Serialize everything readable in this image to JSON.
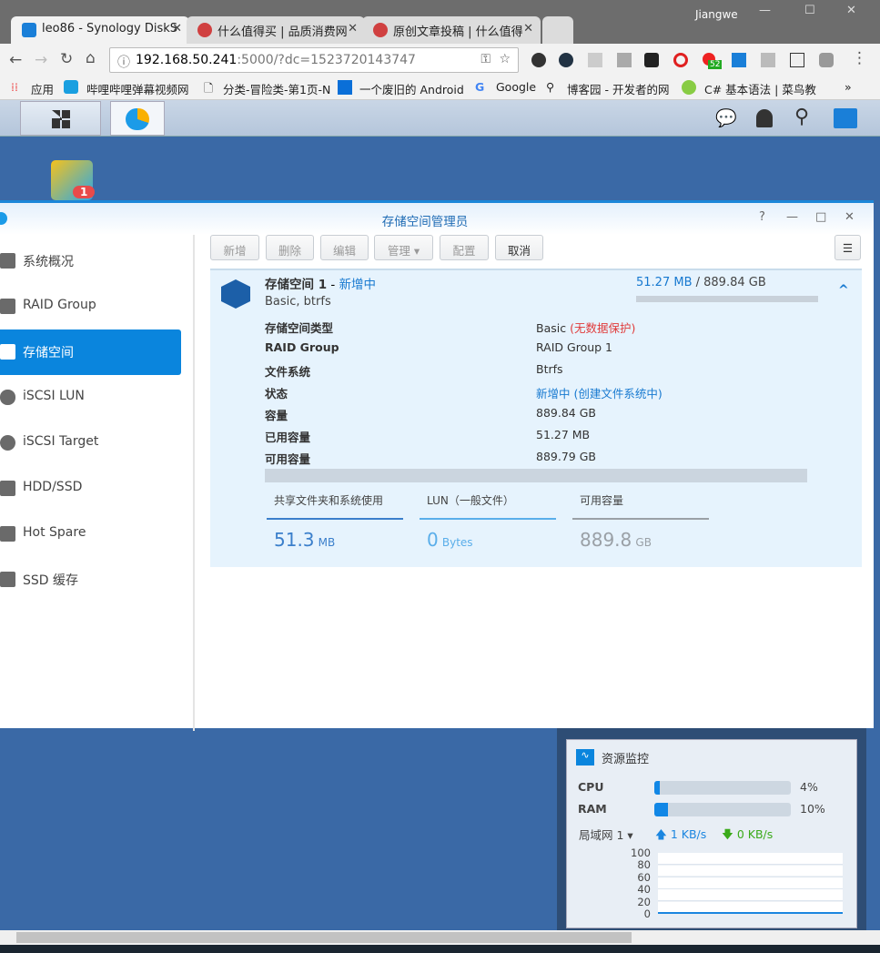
{
  "browser": {
    "user": "Jiangwe",
    "tabs": [
      {
        "label": "leo86 - Synology DiskS"
      },
      {
        "label": "什么值得买 | 品质消费网"
      },
      {
        "label": "原创文章投稿 | 什么值得"
      }
    ],
    "url_host": "192.168.50.241",
    "url_rest": ":5000/?dc=1523720143747",
    "ext_badge": "52",
    "bookmarks": [
      "应用",
      "哔哩哔哩弹幕视频网",
      "分类-冒险类-第1页-N",
      "一个废旧的 Android",
      "Google",
      "博客园 - 开发者的网",
      "C# 基本语法 | 菜鸟教"
    ],
    "more": "»"
  },
  "desktop": {
    "badge": "1"
  },
  "window": {
    "title": "存储空间管理员",
    "controls": [
      "?",
      "—",
      "□",
      "✕"
    ]
  },
  "sidebar": {
    "items": [
      {
        "label": "系统概况",
        "icon": "overview-icon"
      },
      {
        "label": "RAID Group",
        "icon": "raid-icon"
      },
      {
        "label": "存储空间",
        "icon": "volume-icon",
        "active": true
      },
      {
        "label": "iSCSI LUN",
        "icon": "lun-icon"
      },
      {
        "label": "iSCSI Target",
        "icon": "globe-icon"
      },
      {
        "label": "HDD/SSD",
        "icon": "disk-icon"
      },
      {
        "label": "Hot Spare",
        "icon": "hot-spare-icon"
      },
      {
        "label": "SSD 缓存",
        "icon": "ssd-cache-icon"
      }
    ]
  },
  "toolbar": {
    "buttons": [
      "新增",
      "删除",
      "编辑",
      "管理 ▾",
      "配置",
      "取消"
    ]
  },
  "volume": {
    "name": "存储空间 1",
    "sep": " - ",
    "status": "新增中",
    "subtitle": "Basic, btrfs",
    "used": "51.27 MB",
    "total": " / 889.84 GB",
    "usage_fraction": 0.0001,
    "details": [
      {
        "label": "存储空间类型",
        "value": "Basic ",
        "extra": "(无数据保护)"
      },
      {
        "label": "RAID Group",
        "value": "RAID Group 1"
      },
      {
        "label": "文件系统",
        "value": "Btrfs"
      },
      {
        "label": "状态",
        "value": "新增中 ",
        "extra": "(创建文件系统中)"
      },
      {
        "label": "容量",
        "value": "889.84 GB"
      },
      {
        "label": "已用容量",
        "value": "51.27 MB"
      },
      {
        "label": "可用容量",
        "value": "889.79 GB"
      }
    ],
    "stats": [
      {
        "label": "共享文件夹和系统使用",
        "value": "51.3",
        "unit": "MB",
        "color": "#3b7fcb"
      },
      {
        "label": "LUN（一般文件）",
        "value": "0",
        "unit": "Bytes",
        "color": "#5aaeea"
      },
      {
        "label": "可用容量",
        "value": "889.8",
        "unit": "GB",
        "color": "#9aa0a6"
      }
    ]
  },
  "monitor": {
    "title": "资源监控",
    "cpu_label": "CPU",
    "cpu": "4%",
    "cpu_fraction": 0.04,
    "ram_label": "RAM",
    "ram": "10%",
    "ram_fraction": 0.1,
    "net": "局域网 1",
    "up": "1 KB/s",
    "down": "0 KB/s",
    "yticks": [
      "100",
      "80",
      "60",
      "40",
      "20",
      "0"
    ]
  }
}
